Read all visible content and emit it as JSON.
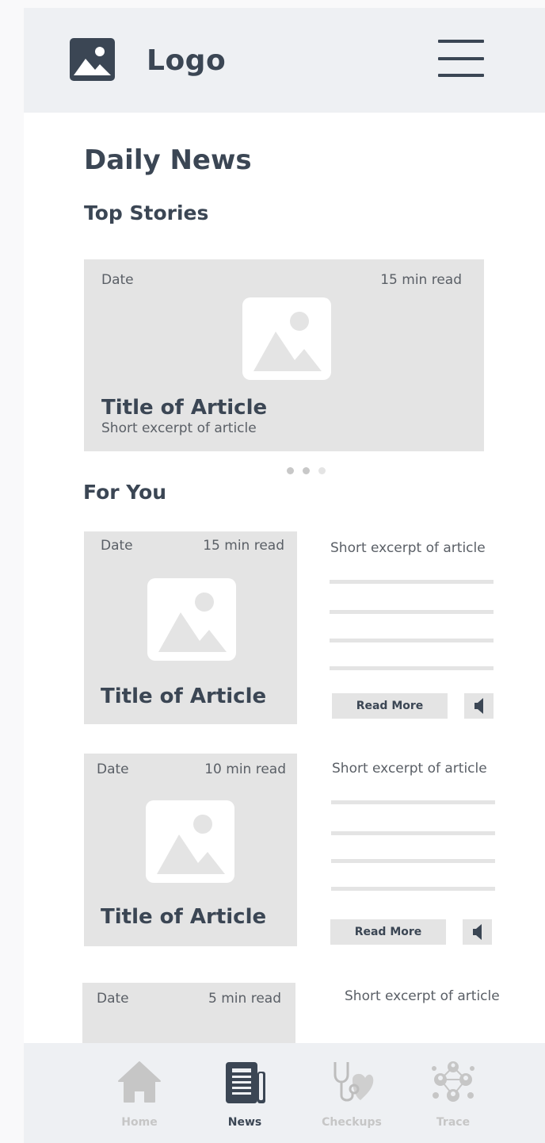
{
  "header": {
    "logo_text": "Logo"
  },
  "page_title": "Daily News",
  "top_stories": {
    "heading": "Top Stories",
    "card": {
      "date": "Date",
      "read_time": "15 min read",
      "title": "Title of Article",
      "excerpt": "Short excerpt of article"
    },
    "carousel_dots": {
      "count": 3,
      "active_index": 0
    }
  },
  "for_you": {
    "heading": "For You",
    "items": [
      {
        "date": "Date",
        "read_time": "15 min read",
        "title": "Title of Article",
        "excerpt": "Short excerpt of article",
        "read_more": "Read More"
      },
      {
        "date": "Date",
        "read_time": "10 min read",
        "title": "Title of Article",
        "excerpt": "Short excerpt of article",
        "read_more": "Read More"
      },
      {
        "date": "Date",
        "read_time": "5 min read",
        "excerpt": "Short excerpt of article"
      }
    ]
  },
  "bottom_nav": {
    "items": [
      {
        "label": "Home",
        "icon": "home-icon",
        "active": false
      },
      {
        "label": "News",
        "icon": "newspaper-icon",
        "active": true
      },
      {
        "label": "Checkups",
        "icon": "stethoscope-heart-icon",
        "active": false
      },
      {
        "label": "Trace",
        "icon": "network-people-icon",
        "active": false
      }
    ]
  },
  "colors": {
    "primary_text": "#3b4654",
    "secondary_text": "#5a5f66",
    "placeholder_fill": "#e4e4e4",
    "header_bg": "#eef0f3",
    "nav_inactive": "#c6c6c6"
  }
}
